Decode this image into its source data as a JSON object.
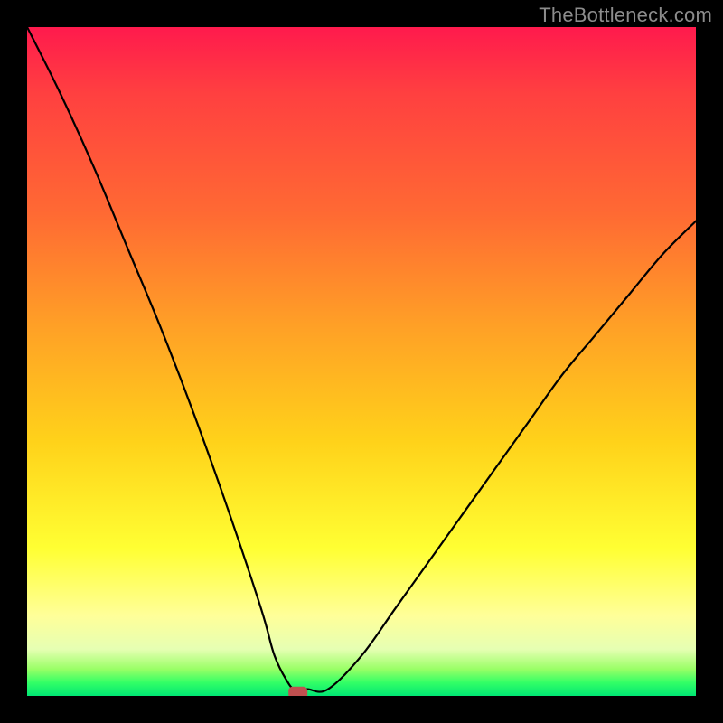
{
  "watermark": "TheBottleneck.com",
  "colors": {
    "curve_stroke": "#000000",
    "marker_fill": "#c05050",
    "frame_bg": "#000000"
  },
  "chart_data": {
    "type": "line",
    "title": "",
    "xlabel": "",
    "ylabel": "",
    "xlim": [
      0,
      100
    ],
    "ylim": [
      0,
      100
    ],
    "grid": false,
    "legend": false,
    "series": [
      {
        "name": "bottleneck-curve",
        "x": [
          0,
          5,
          10,
          15,
          20,
          25,
          30,
          35,
          37,
          39,
          40,
          41,
          42,
          45,
          50,
          55,
          60,
          65,
          70,
          75,
          80,
          85,
          90,
          95,
          100
        ],
        "values": [
          100,
          90,
          79,
          67,
          55,
          42,
          28,
          13,
          6,
          2,
          1,
          1,
          1,
          1,
          6,
          13,
          20,
          27,
          34,
          41,
          48,
          54,
          60,
          66,
          71
        ]
      }
    ],
    "marker": {
      "x": 40.5,
      "y": 0.5,
      "shape": "rounded-rect"
    },
    "background_gradient": {
      "direction": "top-to-bottom",
      "stops": [
        {
          "pos": 0.0,
          "color": "#ff1a4d"
        },
        {
          "pos": 0.28,
          "color": "#ff6a33"
        },
        {
          "pos": 0.62,
          "color": "#ffd21a"
        },
        {
          "pos": 0.88,
          "color": "#ffff99"
        },
        {
          "pos": 1.0,
          "color": "#00e673"
        }
      ]
    }
  }
}
